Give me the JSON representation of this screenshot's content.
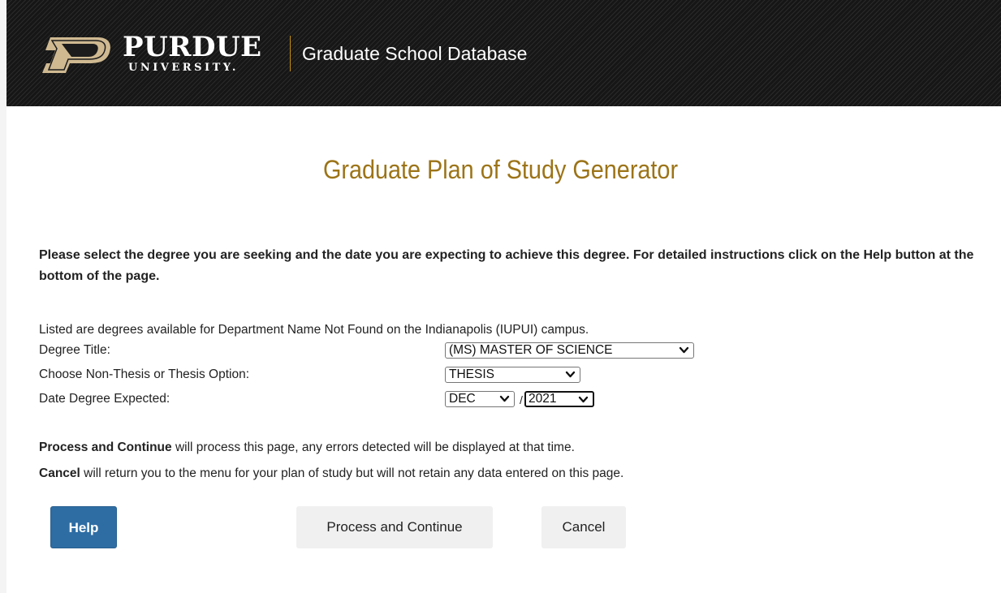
{
  "header": {
    "logo_word": "PURDUE",
    "logo_sub": "UNIVERSITY.",
    "app_title": "Graduate School Database",
    "colors": {
      "gold": "#c28e0e",
      "background": "#1c1c1c"
    }
  },
  "page": {
    "title": "Graduate Plan of Study Generator",
    "title_color": "#9c7418",
    "intro": "Please select the degree you are seeking and the date you are expecting to achieve this degree. For detailed instructions click on the Help button at the bottom of the page.",
    "listing_note": "Listed are degrees available for Department Name Not Found on the Indianapolis (IUPUI) campus."
  },
  "form": {
    "degree_title_label": "Degree Title:",
    "degree_title_value": "(MS) MASTER OF SCIENCE",
    "option_label": "Choose Non-Thesis or Thesis Option:",
    "option_value": "THESIS",
    "date_label": "Date Degree Expected:",
    "month_value": "DEC",
    "date_separator": "/",
    "year_value": "2021"
  },
  "notes": {
    "process_keyword": "Process and Continue",
    "process_text": " will process this page, any errors detected will be displayed at that time.",
    "cancel_keyword": "Cancel",
    "cancel_text": " will return you to the menu for your plan of study but will not retain any data entered on this page."
  },
  "buttons": {
    "help": "Help",
    "process": "Process and Continue",
    "cancel": "Cancel",
    "help_color": "#2e6da4"
  },
  "icons": {
    "logo": "purdue-p-logo-icon",
    "dropdown": "chevron-down-icon"
  }
}
